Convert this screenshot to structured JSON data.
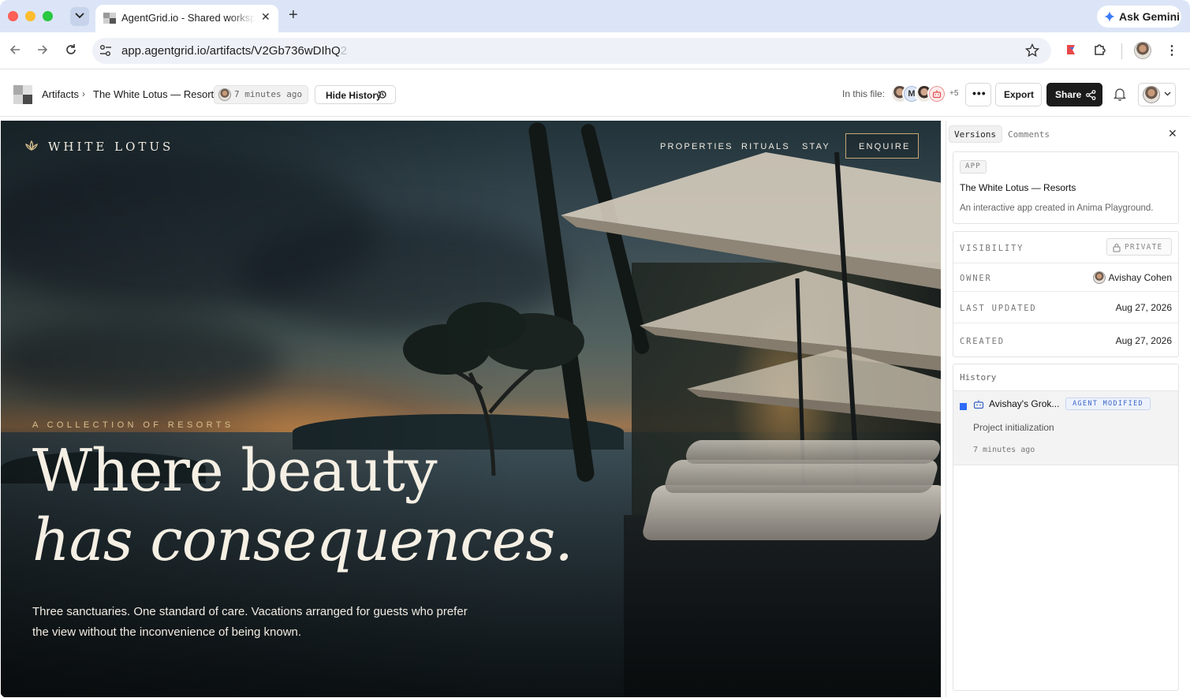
{
  "browser": {
    "tab_title": "AgentGrid.io - Shared workspace",
    "url": "app.agentgrid.io/artifacts/V2Gb736wDIhQ2",
    "url_visible": "app.agentgrid.io/artifacts/V2Gb736wDIhQ",
    "url_faded": "2",
    "gemini_label": "Ask Gemini",
    "icons": [
      "chevron-down-icon",
      "close-icon",
      "plus-icon",
      "back-icon",
      "forward-icon",
      "reload-icon",
      "site-settings-icon",
      "star-icon",
      "extension-icon",
      "puzzle-icon",
      "avatar",
      "menu-icon"
    ]
  },
  "header": {
    "breadcrumb_root": "Artifacts",
    "breadcrumb_current": "The White Lotus — Resorts",
    "updated_time": "7 minutes ago",
    "hide_history_label": "Hide History",
    "in_this_file_label": "In this file:",
    "collaborator_initial": "M",
    "collaborators_more": "+5",
    "more_label": "•••",
    "export_label": "Export",
    "share_label": "Share"
  },
  "preview": {
    "brand": "WHITE LOTUS",
    "nav": [
      "PROPERTIES",
      "RITUALS",
      "STAY"
    ],
    "cta": "ENQUIRE",
    "eyebrow": "A COLLECTION OF RESORTS",
    "headline_line1": "Where beauty",
    "headline_line2": "has consequences.",
    "subtitle": "Three sanctuaries. One standard of care. Vacations arranged for guests who prefer the view without the inconvenience of being known."
  },
  "panel": {
    "tabs": [
      "Versions",
      "Comments"
    ],
    "active_tab": "Versions",
    "app_badge": "APP",
    "app_title": "The White Lotus — Resorts",
    "app_description": "An interactive app created in Anima Playground.",
    "meta": {
      "visibility_label": "VISIBILITY",
      "visibility_value": "PRIVATE",
      "owner_label": "OWNER",
      "owner_value": "Avishay Cohen",
      "last_updated_label": "LAST UPDATED",
      "last_updated_value": "Aug 27, 2026",
      "created_label": "CREATED",
      "created_value": "Aug 27, 2026"
    },
    "history_title": "History",
    "history": [
      {
        "author": "Avishay's Grok...",
        "badge": "AGENT MODIFIED",
        "message": "Project initialization",
        "time": "7 minutes ago"
      }
    ]
  },
  "colors": {
    "tabstrip": "#dbe5f7",
    "share_button": "#1b1b1b",
    "history_marker": "#2f6cf6",
    "agent_badge_text": "#3a64c8",
    "hero_gold": "#d8c090"
  }
}
